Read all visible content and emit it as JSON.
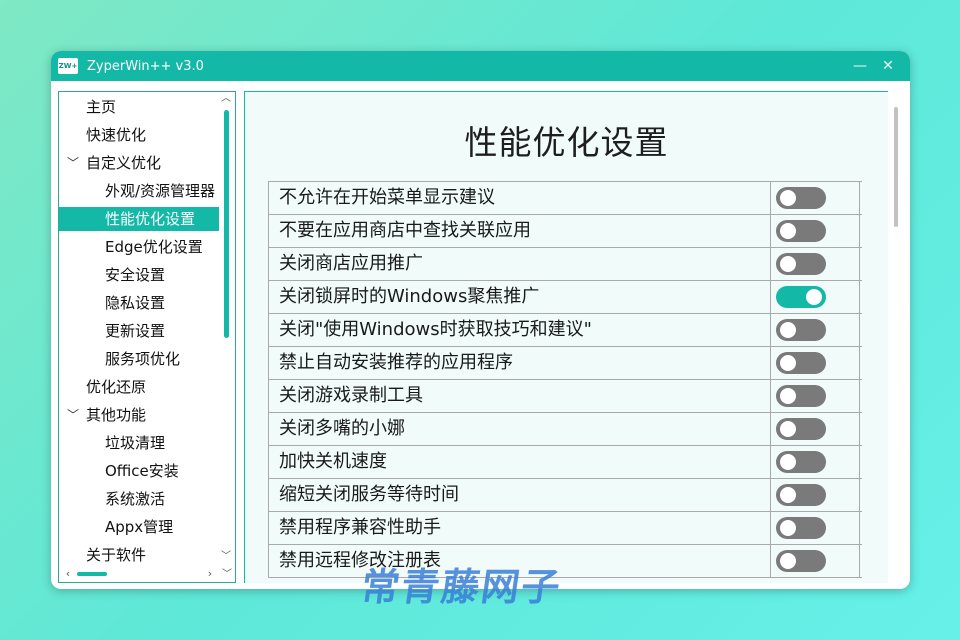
{
  "window": {
    "icon_text": "ZW+",
    "title": "ZyperWin++ v3.0",
    "minimize": "—",
    "close": "✕"
  },
  "sidebar": {
    "items": [
      {
        "label": "主页",
        "level": 0
      },
      {
        "label": "快速优化",
        "level": 0
      },
      {
        "label": "自定义优化",
        "level": 0,
        "expanded": true
      },
      {
        "label": "外观/资源管理器",
        "level": 1
      },
      {
        "label": "性能优化设置",
        "level": 1,
        "selected": true
      },
      {
        "label": "Edge优化设置",
        "level": 1
      },
      {
        "label": "安全设置",
        "level": 1
      },
      {
        "label": "隐私设置",
        "level": 1
      },
      {
        "label": "更新设置",
        "level": 1
      },
      {
        "label": "服务项优化",
        "level": 1
      },
      {
        "label": "优化还原",
        "level": 0
      },
      {
        "label": "其他功能",
        "level": 0,
        "expanded": true
      },
      {
        "label": "垃圾清理",
        "level": 1
      },
      {
        "label": "Office安装",
        "level": 1
      },
      {
        "label": "系统激活",
        "level": 1
      },
      {
        "label": "Appx管理",
        "level": 1
      },
      {
        "label": "关于软件",
        "level": 0
      }
    ]
  },
  "main": {
    "title": "性能优化设置",
    "settings": [
      {
        "label": "不允许在开始菜单显示建议",
        "on": false
      },
      {
        "label": "不要在应用商店中查找关联应用",
        "on": false
      },
      {
        "label": "关闭商店应用推广",
        "on": false
      },
      {
        "label": "关闭锁屏时的Windows聚焦推广",
        "on": true
      },
      {
        "label": "关闭\"使用Windows时获取技巧和建议\"",
        "on": false
      },
      {
        "label": "禁止自动安装推荐的应用程序",
        "on": false
      },
      {
        "label": "关闭游戏录制工具",
        "on": false
      },
      {
        "label": "关闭多嘴的小娜",
        "on": false
      },
      {
        "label": "加快关机速度",
        "on": false
      },
      {
        "label": "缩短关闭服务等待时间",
        "on": false
      },
      {
        "label": "禁用程序兼容性助手",
        "on": false
      },
      {
        "label": "禁用远程修改注册表",
        "on": false
      }
    ]
  },
  "watermark": "常青藤网子",
  "colors": {
    "accent": "#14b8a6",
    "toggle_off": "#7a7a7a"
  }
}
